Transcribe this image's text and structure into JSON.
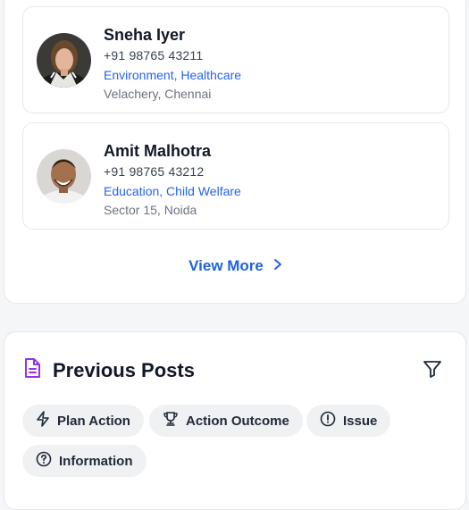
{
  "volunteers": [
    {
      "name": "Sneha Iyer",
      "phone": "+91 98765 43211",
      "causes": "Environment, Healthcare",
      "location": "Velachery, Chennai"
    },
    {
      "name": "Amit Malhotra",
      "phone": "+91 98765 43212",
      "causes": "Education, Child Welfare",
      "location": "Sector 15, Noida"
    }
  ],
  "view_more_label": "View More",
  "posts": {
    "title": "Previous Posts",
    "filters": [
      "Plan Action",
      "Action Outcome",
      "Issue",
      "Information"
    ]
  },
  "colors": {
    "accent": "#1d64d8",
    "causes_text": "#2563eb",
    "document_icon": "#9333ea",
    "chip_bg": "#f0f1f3"
  }
}
